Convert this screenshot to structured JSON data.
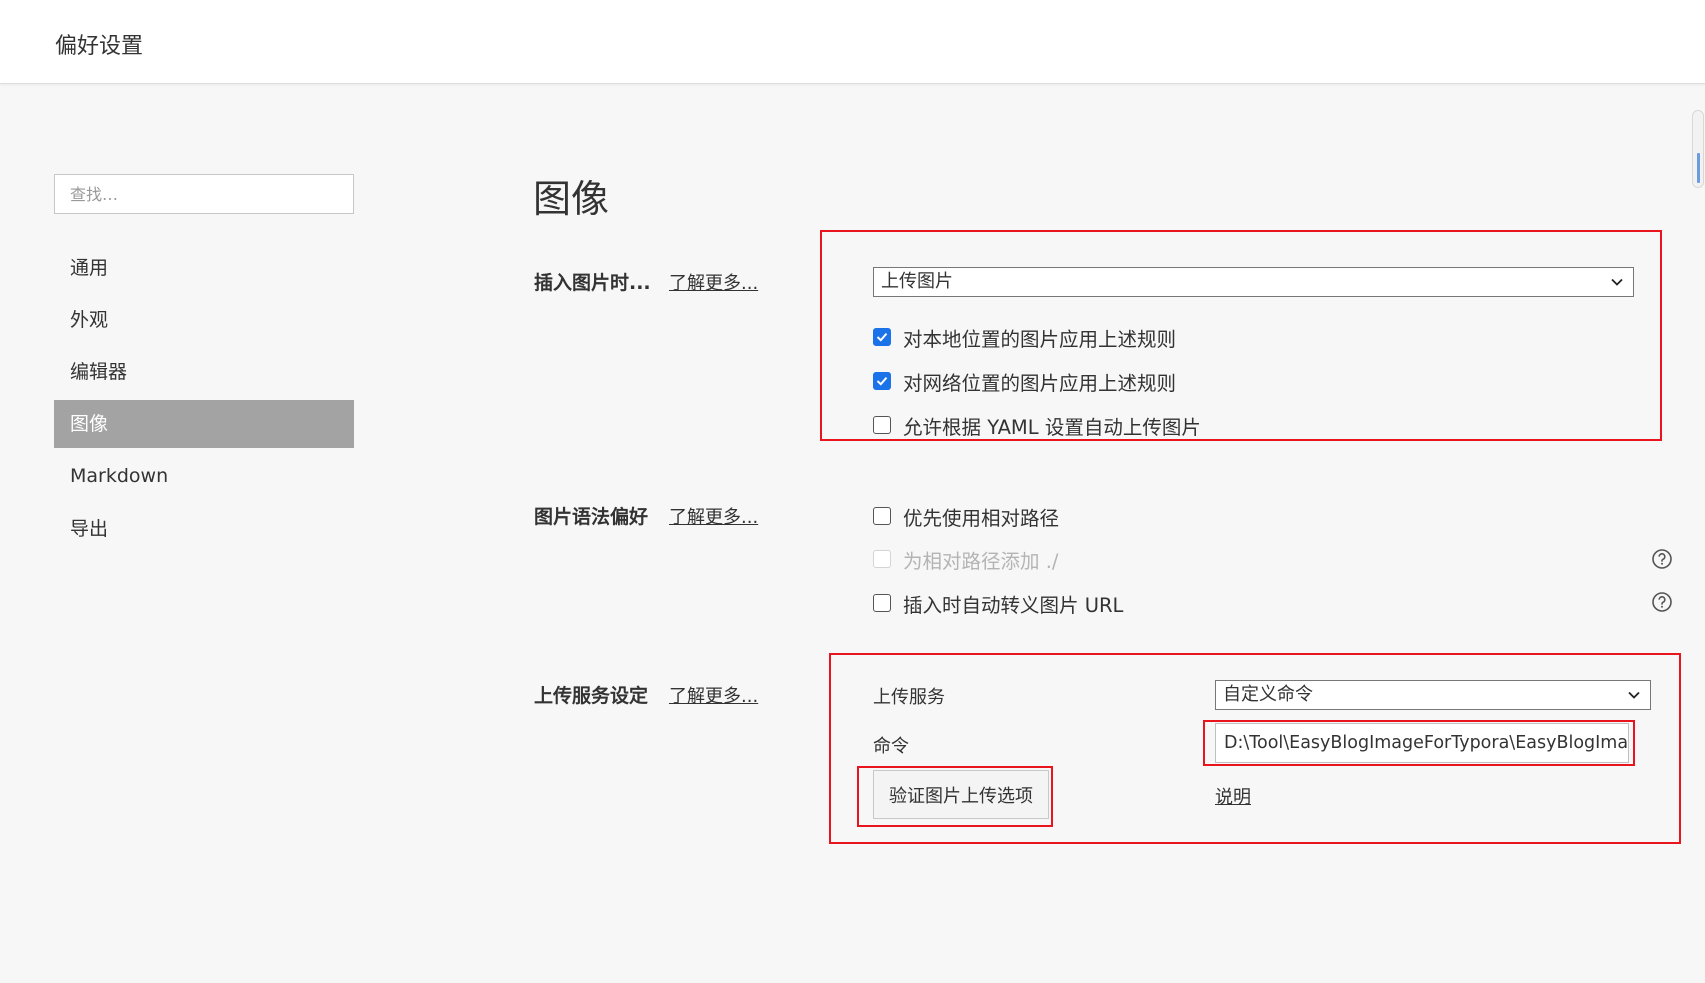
{
  "window": {
    "title": "偏好设置"
  },
  "sidebar": {
    "search_placeholder": "查找…",
    "items": [
      {
        "label": "通用"
      },
      {
        "label": "外观"
      },
      {
        "label": "编辑器"
      },
      {
        "label": "图像"
      },
      {
        "label": "Markdown"
      },
      {
        "label": "导出"
      }
    ]
  },
  "main": {
    "title": "图像",
    "insert_image": {
      "label": "插入图片时...",
      "learn_more": "了解更多...",
      "select_value": "上传图片",
      "options": [
        {
          "label": "对本地位置的图片应用上述规则",
          "checked": true
        },
        {
          "label": "对网络位置的图片应用上述规则",
          "checked": true
        },
        {
          "label": "允许根据 YAML 设置自动上传图片",
          "checked": false
        }
      ]
    },
    "syntax": {
      "label": "图片语法偏好",
      "learn_more": "了解更多...",
      "options": [
        {
          "label": "优先使用相对路径",
          "checked": false
        },
        {
          "label": "为相对路径添加 ./",
          "checked": false,
          "disabled": true
        },
        {
          "label": "插入时自动转义图片 URL",
          "checked": false
        }
      ]
    },
    "upload": {
      "label": "上传服务设定",
      "learn_more": "了解更多...",
      "service_label": "上传服务",
      "service_value": "自定义命令",
      "command_label": "命令",
      "command_value": "D:\\Tool\\EasyBlogImageForTypora\\EasyBlogImage",
      "verify_button": "验证图片上传选项",
      "doc_link": "说明"
    }
  },
  "colors": {
    "accent": "#1a73e8",
    "annotation": "#e8141e",
    "sidebar_active": "#a3a3a3"
  }
}
